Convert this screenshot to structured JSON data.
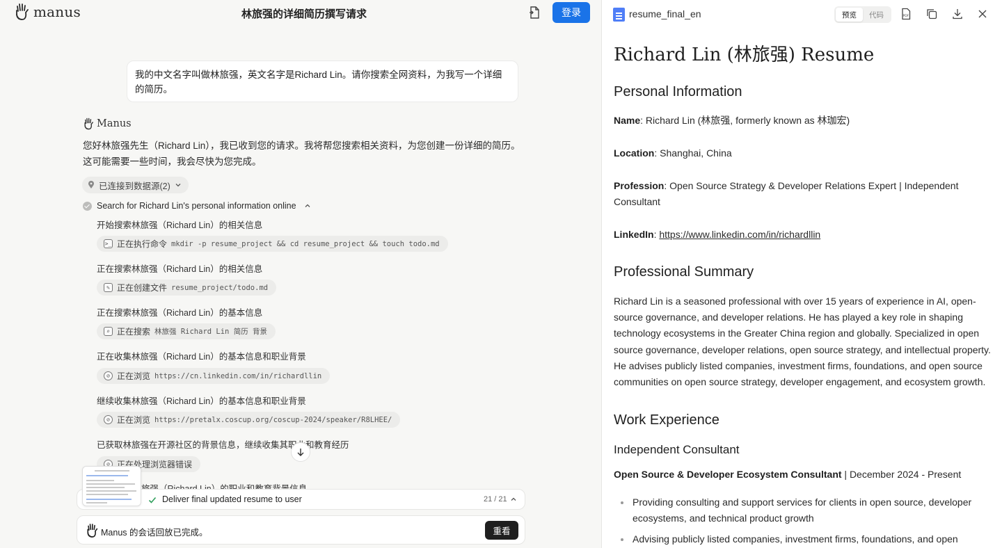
{
  "header": {
    "logo_text": "manus",
    "chat_title": "林旅强的详细简历撰写请求",
    "login_label": "登录"
  },
  "chat": {
    "user_message": "我的中文名字叫做林旅强，英文名字是Richard Lin。请你搜索全网资料，为我写一个详细的简历。",
    "assistant_name": "Manus",
    "assistant_reply": "您好林旅强先生（Richard Lin），我已收到您的请求。我将帮您搜索相关资料，为您创建一份详细的简历。这可能需要一些时间，我会尽快为您完成。",
    "datasource_label": "已连接到数据源(2)",
    "step_title": "Search for Richard Lin's personal information online",
    "sub_steps": [
      {
        "text": "开始搜索林旅强（Richard Lin）的相关信息",
        "action_label": "正在执行命令",
        "action_detail": "mkdir -p resume_project && cd resume_project && touch todo.md",
        "icon": "terminal-icon"
      },
      {
        "text": "正在搜索林旅强（Richard Lin）的相关信息",
        "action_label": "正在创建文件",
        "action_detail": "resume_project/todo.md",
        "icon": "edit-icon"
      },
      {
        "text": "正在搜索林旅强（Richard Lin）的基本信息",
        "action_label": "正在搜索",
        "action_detail": "林旅强 Richard Lin 简历 背景",
        "icon": "search-icon"
      },
      {
        "text": "正在收集林旅强（Richard Lin）的基本信息和职业背景",
        "action_label": "正在浏览",
        "action_detail": "https://cn.linkedin.com/in/richardllin",
        "icon": "browser-icon"
      },
      {
        "text": "继续收集林旅强（Richard Lin）的基本信息和职业背景",
        "action_label": "正在浏览",
        "action_detail": "https://pretalx.coscup.org/coscup-2024/speaker/R8LHEE/",
        "icon": "browser-icon"
      },
      {
        "text": "已获取林旅强在开源社区的背景信息，继续收集其职业和教育经历",
        "action_label": "正在处理浏览器错误",
        "action_detail": "",
        "icon": "browser-icon"
      }
    ],
    "partial_line": "旅强（Richard Lin）的职业和教育背景信息",
    "progress_text": "Deliver final updated resume to user",
    "progress_count": "21 / 21",
    "done_text": "Manus 的会话回放已完成。",
    "replay_label": "重看"
  },
  "preview": {
    "file_name": "resume_final_en",
    "tab_preview": "预览",
    "tab_code": "代码",
    "title": "Richard Lin (林旅强) Resume",
    "personal_heading": "Personal Information",
    "name_label": "Name",
    "name_value": ": Richard Lin (林旅强, formerly known as 林珈宏)",
    "location_label": "Location",
    "location_value": ": Shanghai, China",
    "profession_label": "Profession",
    "profession_value": ": Open Source Strategy & Developer Relations Expert | Independent Consultant",
    "linkedin_label": "LinkedIn",
    "linkedin_sep": ": ",
    "linkedin_url": "https://www.linkedin.com/in/richardllin",
    "summary_heading": "Professional Summary",
    "summary_text": "Richard Lin is a seasoned professional with over 15 years of experience in AI, open-source governance, and developer relations. He has played a key role in shaping technology ecosystems in the Greater China region and globally. Specialized in open source governance, developer relations, open source strategy, and intellectual property. He advises publicly listed companies, investment firms, foundations, and open source communities on open source strategy, developer engagement, and ecosystem growth.",
    "work_heading": "Work Experience",
    "job_heading": "Independent Consultant",
    "role_title": "Open Source & Developer Ecosystem Consultant",
    "role_period": " | December 2024 - Present",
    "bullets": [
      "Providing consulting and support services for clients in open source, developer ecosystems, and technical product growth",
      "Advising publicly listed companies, investment firms, foundations, and open source communities"
    ]
  },
  "colors": {
    "accent": "#1a73e8",
    "file_icon": "#4f7ef7",
    "replay_button": "#1f1f1f"
  }
}
